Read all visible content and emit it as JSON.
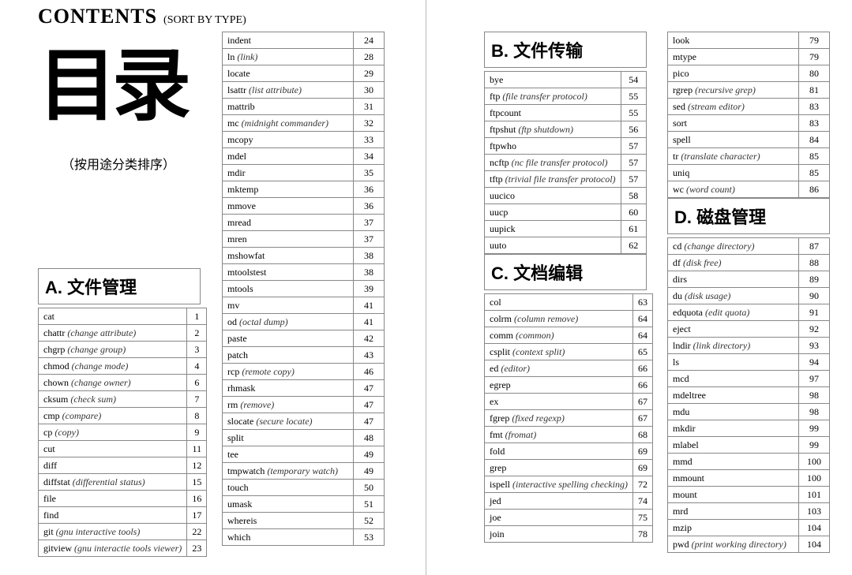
{
  "header": {
    "contents": "CONTENTS",
    "sort": "(SORT BY TYPE)",
    "big": "目录",
    "caption": "（按用途分类排序）"
  },
  "sections": {
    "A": "A. 文件管理",
    "B": "B. 文件传输",
    "C": "C. 文档编辑",
    "D": "D. 磁盘管理"
  },
  "col1": [
    {
      "sec": "A"
    },
    {
      "cmd": "cat",
      "pg": 1
    },
    {
      "cmd": "chattr",
      "note": "(change attribute)",
      "pg": 2
    },
    {
      "cmd": "chgrp",
      "note": "(change group)",
      "pg": 3
    },
    {
      "cmd": "chmod",
      "note": "(change mode)",
      "pg": 4
    },
    {
      "cmd": "chown",
      "note": "(change owner)",
      "pg": 6
    },
    {
      "cmd": "cksum",
      "note": "(check sum)",
      "pg": 7
    },
    {
      "cmd": "cmp",
      "note": "(compare)",
      "pg": 8
    },
    {
      "cmd": "cp",
      "note": "(copy)",
      "pg": 9
    },
    {
      "cmd": "cut",
      "pg": 11
    },
    {
      "cmd": "diff",
      "pg": 12
    },
    {
      "cmd": "diffstat",
      "note": "(differential status)",
      "pg": 15
    },
    {
      "cmd": "file",
      "pg": 16
    },
    {
      "cmd": "find",
      "pg": 17
    },
    {
      "cmd": "git",
      "note": "(gnu interactive tools)",
      "pg": 22
    },
    {
      "cmd": "gitview",
      "note": "(gnu interactie tools viewer)",
      "pg": 23
    }
  ],
  "col2": [
    {
      "cmd": "indent",
      "pg": 24
    },
    {
      "cmd": "ln",
      "note": "(link)",
      "pg": 28
    },
    {
      "cmd": "locate",
      "pg": 29
    },
    {
      "cmd": "lsattr",
      "note": "(list attribute)",
      "pg": 30
    },
    {
      "cmd": "mattrib",
      "pg": 31
    },
    {
      "cmd": "mc",
      "note": "(midnight commander)",
      "pg": 32
    },
    {
      "cmd": "mcopy",
      "pg": 33
    },
    {
      "cmd": "mdel",
      "pg": 34
    },
    {
      "cmd": "mdir",
      "pg": 35
    },
    {
      "cmd": "mktemp",
      "pg": 36
    },
    {
      "cmd": "mmove",
      "pg": 36
    },
    {
      "cmd": "mread",
      "pg": 37
    },
    {
      "cmd": "mren",
      "pg": 37
    },
    {
      "cmd": "mshowfat",
      "pg": 38
    },
    {
      "cmd": "mtoolstest",
      "pg": 38
    },
    {
      "cmd": "mtools",
      "pg": 39
    },
    {
      "cmd": "mv",
      "pg": 41
    },
    {
      "cmd": "od",
      "note": "(octal dump)",
      "pg": 41
    },
    {
      "cmd": "paste",
      "pg": 42
    },
    {
      "cmd": "patch",
      "pg": 43
    },
    {
      "cmd": "rcp",
      "note": "(remote copy)",
      "pg": 46
    },
    {
      "cmd": "rhmask",
      "pg": 47
    },
    {
      "cmd": "rm",
      "note": "(remove)",
      "pg": 47
    },
    {
      "cmd": "slocate",
      "note": "(secure locate)",
      "pg": 47
    },
    {
      "cmd": "split",
      "pg": 48
    },
    {
      "cmd": "tee",
      "pg": 49
    },
    {
      "cmd": "tmpwatch",
      "note": "(temporary watch)",
      "pg": 49
    },
    {
      "cmd": "touch",
      "pg": 50
    },
    {
      "cmd": "umask",
      "pg": 51
    },
    {
      "cmd": "whereis",
      "pg": 52
    },
    {
      "cmd": "which",
      "pg": 53
    }
  ],
  "col3": [
    {
      "sec": "B"
    },
    {
      "cmd": "bye",
      "pg": 54
    },
    {
      "cmd": "ftp",
      "note": "(file transfer protocol)",
      "pg": 55
    },
    {
      "cmd": "ftpcount",
      "pg": 55
    },
    {
      "cmd": "ftpshut",
      "note": "(ftp shutdown)",
      "pg": 56
    },
    {
      "cmd": "ftpwho",
      "pg": 57
    },
    {
      "cmd": "ncftp",
      "note": "(nc file transfer protocol)",
      "pg": 57
    },
    {
      "cmd": "tftp",
      "note": "(trivial file transfer protocol)",
      "pg": 57
    },
    {
      "cmd": "uucico",
      "pg": 58
    },
    {
      "cmd": "uucp",
      "pg": 60
    },
    {
      "cmd": "uupick",
      "pg": 61
    },
    {
      "cmd": "uuto",
      "pg": 62
    },
    {
      "sec": "C"
    },
    {
      "cmd": "col",
      "pg": 63
    },
    {
      "cmd": "colrm",
      "note": "(column remove)",
      "pg": 64
    },
    {
      "cmd": "comm",
      "note": "(common)",
      "pg": 64
    },
    {
      "cmd": "csplit",
      "note": "(context split)",
      "pg": 65
    },
    {
      "cmd": "ed",
      "note": "(editor)",
      "pg": 66
    },
    {
      "cmd": "egrep",
      "pg": 66
    },
    {
      "cmd": "ex",
      "pg": 67
    },
    {
      "cmd": "fgrep",
      "note": "(fixed regexp)",
      "pg": 67
    },
    {
      "cmd": "fmt",
      "note": "(fromat)",
      "pg": 68
    },
    {
      "cmd": "fold",
      "pg": 69
    },
    {
      "cmd": "grep",
      "pg": 69
    },
    {
      "cmd": "ispell",
      "note": "(interactive spelling checking)",
      "pg": 72
    },
    {
      "cmd": "jed",
      "pg": 74
    },
    {
      "cmd": "joe",
      "pg": 75
    },
    {
      "cmd": "join",
      "pg": 78
    }
  ],
  "col4": [
    {
      "cmd": "look",
      "pg": 79
    },
    {
      "cmd": "mtype",
      "pg": 79
    },
    {
      "cmd": "pico",
      "pg": 80
    },
    {
      "cmd": "rgrep",
      "note": "(recursive grep)",
      "pg": 81
    },
    {
      "cmd": "sed",
      "note": "(stream editor)",
      "pg": 83
    },
    {
      "cmd": "sort",
      "pg": 83
    },
    {
      "cmd": "spell",
      "pg": 84
    },
    {
      "cmd": "tr",
      "note": "(translate character)",
      "pg": 85
    },
    {
      "cmd": "uniq",
      "pg": 85
    },
    {
      "cmd": "wc",
      "note": "(word count)",
      "pg": 86
    },
    {
      "sec": "D"
    },
    {
      "cmd": "cd",
      "note": "(change directory)",
      "pg": 87
    },
    {
      "cmd": "df",
      "note": "(disk free)",
      "pg": 88
    },
    {
      "cmd": "dirs",
      "pg": 89
    },
    {
      "cmd": "du",
      "note": "(disk usage)",
      "pg": 90
    },
    {
      "cmd": "edquota",
      "note": "(edit quota)",
      "pg": 91
    },
    {
      "cmd": "eject",
      "pg": 92
    },
    {
      "cmd": "lndir",
      "note": "(link directory)",
      "pg": 93
    },
    {
      "cmd": "ls",
      "pg": 94
    },
    {
      "cmd": "mcd",
      "pg": 97
    },
    {
      "cmd": "mdeltree",
      "pg": 98
    },
    {
      "cmd": "mdu",
      "pg": 98
    },
    {
      "cmd": "mkdir",
      "pg": 99
    },
    {
      "cmd": "mlabel",
      "pg": 99
    },
    {
      "cmd": "mmd",
      "pg": 100
    },
    {
      "cmd": "mmount",
      "pg": 100
    },
    {
      "cmd": "mount",
      "pg": 101
    },
    {
      "cmd": "mrd",
      "pg": 103
    },
    {
      "cmd": "mzip",
      "pg": 104
    },
    {
      "cmd": "pwd",
      "note": "(print working directory)",
      "pg": 104
    }
  ]
}
